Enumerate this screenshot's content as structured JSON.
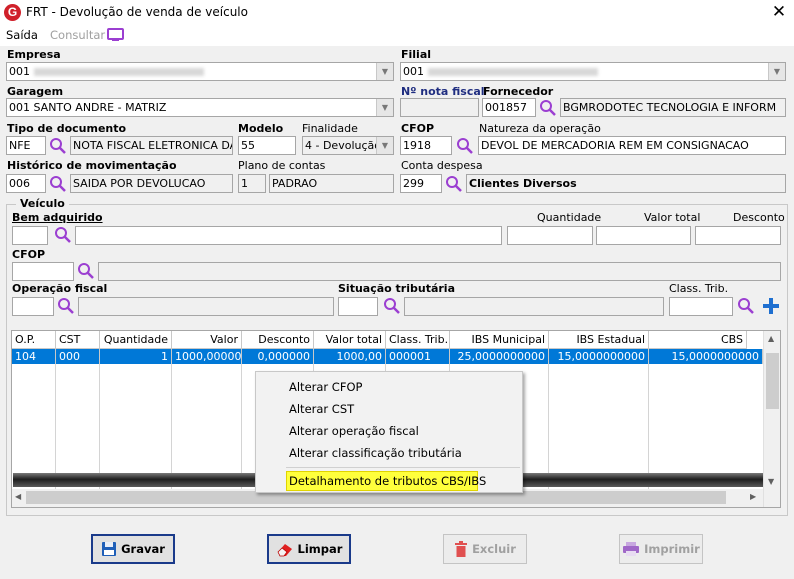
{
  "window": {
    "title": "FRT - Devolução de venda de veículo",
    "close": "✕",
    "logo": "G"
  },
  "menu": {
    "saida": "Saída",
    "consultar": "Consultar"
  },
  "empresa": {
    "label": "Empresa",
    "value": "001"
  },
  "filial": {
    "label": "Filial",
    "value": "001"
  },
  "garagem": {
    "label": "Garagem",
    "value": "001 SANTO ANDRE - MATRIZ"
  },
  "nota_fiscal": {
    "label": "Nº nota fiscal",
    "value": ""
  },
  "fornecedor": {
    "label": "Fornecedor",
    "code": "001857",
    "name": "BGMRODOTEC TECNOLOGIA E INFORM"
  },
  "tipo_documento": {
    "label": "Tipo de documento",
    "code": "NFE",
    "name": "NOTA FISCAL ELETRONICA DA"
  },
  "modelo": {
    "label": "Modelo",
    "value": "55"
  },
  "finalidade": {
    "label": "Finalidade",
    "value": "4 - Devolução"
  },
  "cfop": {
    "label": "CFOP",
    "value": "1918"
  },
  "natureza": {
    "label": "Natureza da operação",
    "value": "DEVOL DE MERCADORIA REM EM CONSIGNACAO"
  },
  "historico": {
    "label": "Histórico de movimentação",
    "code": "006",
    "name": "SAIDA POR DEVOLUCAO"
  },
  "plano_contas": {
    "label": "Plano de contas",
    "code": "1",
    "name": "PADRAO"
  },
  "conta_despesa": {
    "label": "Conta despesa",
    "code": "299",
    "name": "Clientes Diversos"
  },
  "veiculo": {
    "title": "Veículo",
    "bem_label": "Bem adquirido",
    "quantidade_label": "Quantidade",
    "valor_total_label": "Valor total",
    "desconto_label": "Desconto",
    "cfop_label": "CFOP",
    "operacao_label": "Operação fiscal",
    "situacao_label": "Situação tributária",
    "class_label": "Class. Trib."
  },
  "grid": {
    "headers": [
      "O.P.",
      "CST",
      "Quantidade",
      "Valor",
      "Desconto",
      "Valor total",
      "Class. Trib.",
      "IBS Municipal",
      "IBS Estadual",
      "CBS"
    ],
    "row": [
      "104",
      "000",
      "1",
      "1000,000000",
      "0,000000",
      "1000,00",
      "000001",
      "25,0000000000",
      "15,0000000000",
      "15,0000000000"
    ]
  },
  "context_menu": {
    "items": [
      "Alterar CFOP",
      "Alterar CST",
      "Alterar operação fiscal",
      "Alterar classificação tributária"
    ],
    "highlighted": "Detalhamento de tributos CBS/IBS"
  },
  "buttons": {
    "gravar": "Gravar",
    "limpar": "Limpar",
    "excluir": "Excluir",
    "imprimir": "Imprimir"
  },
  "colors": {
    "selection": "#0078d7",
    "highlight": "#ffff3c",
    "search_icon": "#9b3fd1",
    "logo": "#d0202a"
  }
}
